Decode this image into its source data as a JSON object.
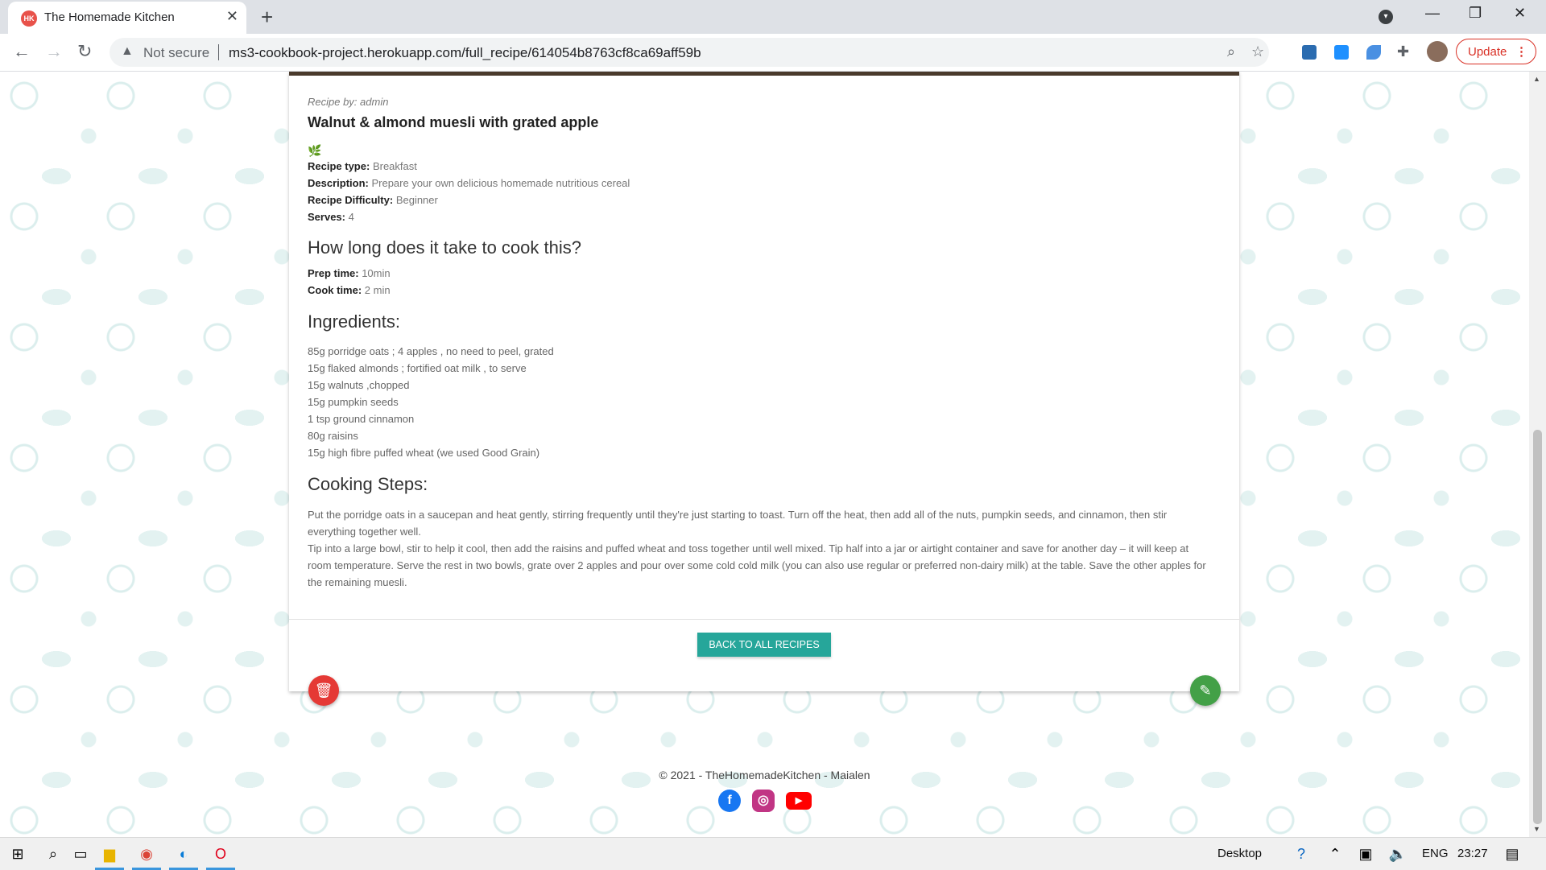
{
  "browser": {
    "tab_title": "The Homemade Kitchen",
    "tab_favicon_text": "HK",
    "new_tab": "+",
    "security_label": "Not secure",
    "url": "ms3-cookbook-project.herokuapp.com/full_recipe/614054b8763cf8ca69aff59b",
    "update_label": "Update"
  },
  "recipe": {
    "recipe_by": "Recipe by: admin",
    "title": "Walnut & almond muesli with grated apple",
    "fields": [
      {
        "label": "Recipe type:",
        "value": "Breakfast"
      },
      {
        "label": "Description:",
        "value": "Prepare your own delicious homemade nutritious cereal"
      },
      {
        "label": "Recipe Difficulty:",
        "value": "Beginner"
      },
      {
        "label": "Serves:",
        "value": "4"
      }
    ],
    "time_heading": "How long does it take to cook this?",
    "prep_label": "Prep time:",
    "prep_value": "10min",
    "cook_label": "Cook time:",
    "cook_value": "2 min",
    "ingredients_heading": "Ingredients:",
    "ingredients": [
      "85g porridge oats ; 4 apples , no need to peel, grated",
      "15g flaked almonds ; fortified oat milk , to serve",
      "15g walnuts ,chopped",
      "15g pumpkin seeds",
      "1 tsp ground cinnamon",
      "80g raisins",
      "15g high fibre puffed wheat (we used Good Grain)"
    ],
    "steps_heading": "Cooking Steps:",
    "steps": [
      "Put the porridge oats in a saucepan and heat gently, stirring frequently until they're just starting to toast. Turn off the heat, then add all of the nuts, pumpkin seeds, and cinnamon, then stir everything together well.",
      "Tip into a large bowl, stir to help it cool, then add the raisins and puffed wheat and toss together until well mixed. Tip half into a jar or airtight container and save for another day – it will keep at room temperature. Serve the rest in two bowls, grate over 2 apples and pour over some cold cold milk (you can also use regular or preferred non-dairy milk) at the table. Save the other apples for the remaining muesli."
    ],
    "back_button": "BACK TO ALL RECIPES"
  },
  "footer": {
    "copyright": "© 2021 - TheHomemadeKitchen - Maialen"
  },
  "taskbar": {
    "desktop_label": "Desktop",
    "language": "ENG",
    "time": "23:27"
  },
  "colors": {
    "accent_teal": "#26a69a",
    "delete_red": "#e53935",
    "edit_green": "#43a047"
  }
}
